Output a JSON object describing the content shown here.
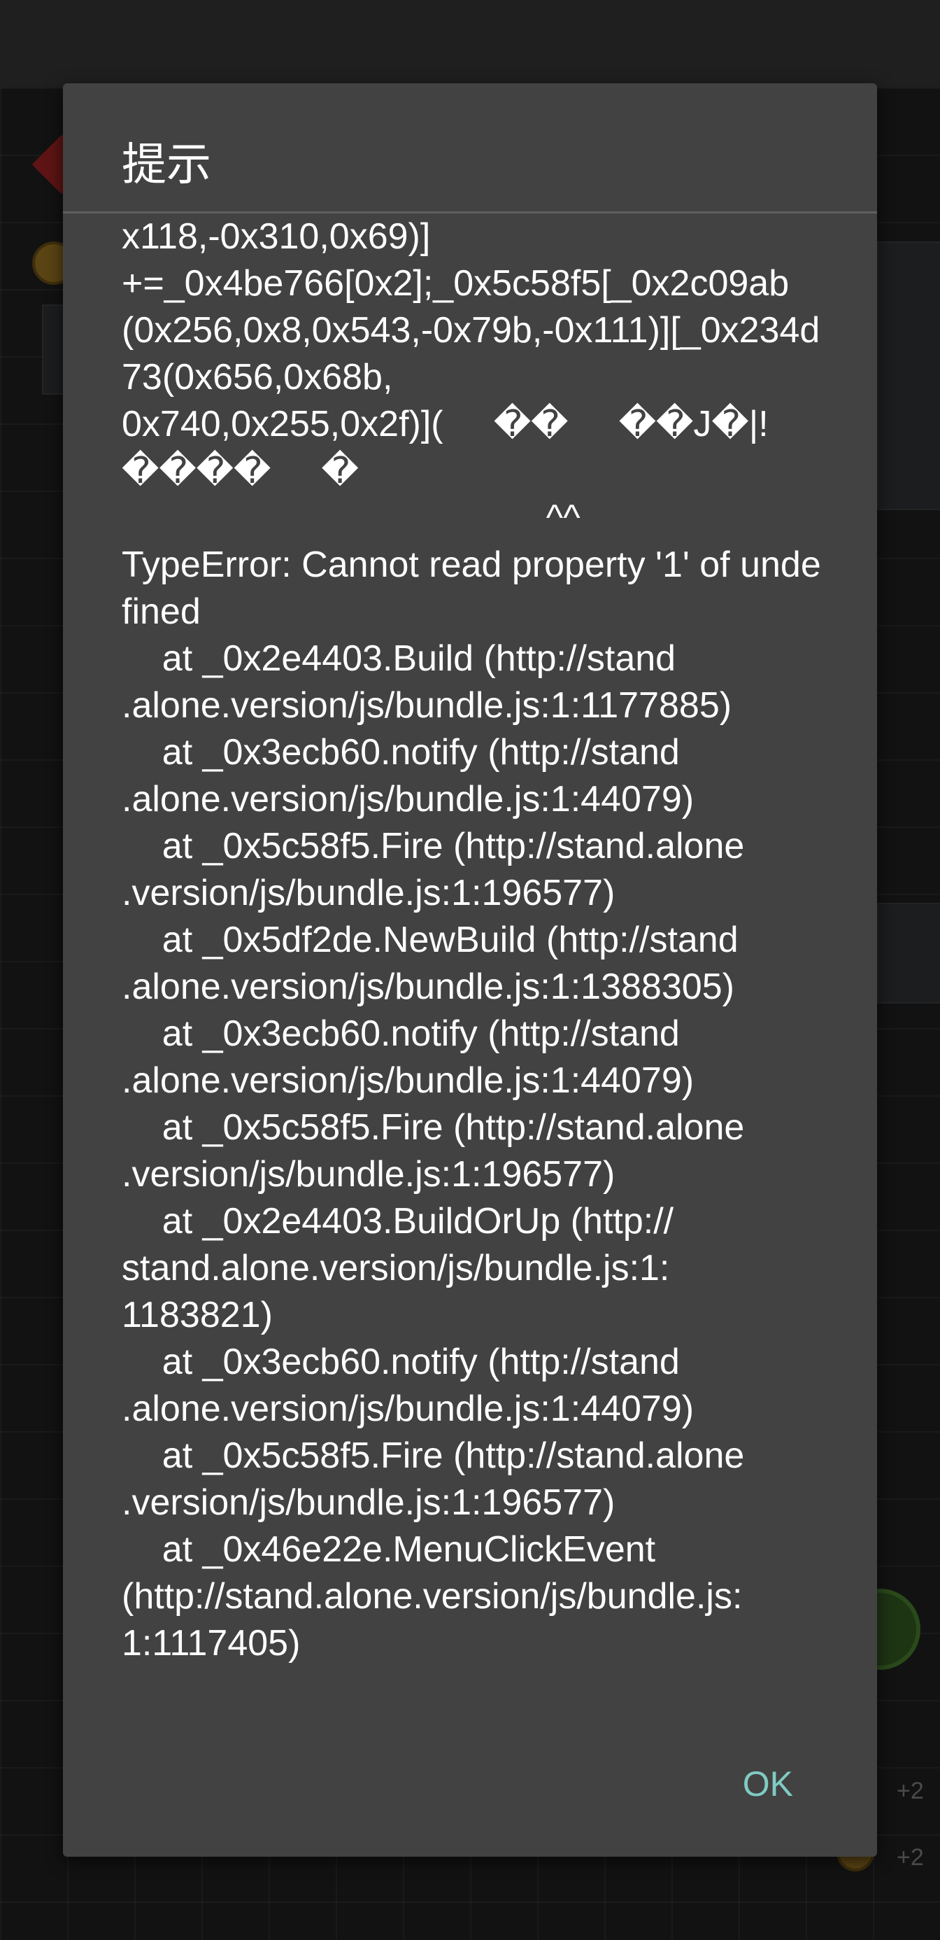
{
  "dialog": {
    "title": "提示",
    "message": "x118,-0x310,0x69)]\n+=_0x4be766[0x2];_0x5c58f5[_0x2c09ab(0x256,0x8,0x543,-0x79b,-0x111)][_0x234d73(0x656,0x68b,\n0x740,0x255,0x2f)](     ��     ��J�|!\n����     �\n                                          ^^\nTypeError: Cannot read property '1' of undefined\n    at _0x2e4403.Build (http://stand\n.alone.version/js/bundle.js:1:1177885)\n    at _0x3ecb60.notify (http://stand\n.alone.version/js/bundle.js:1:44079)\n    at _0x5c58f5.Fire (http://stand.alone\n.version/js/bundle.js:1:196577)\n    at _0x5df2de.NewBuild (http://stand\n.alone.version/js/bundle.js:1:1388305)\n    at _0x3ecb60.notify (http://stand\n.alone.version/js/bundle.js:1:44079)\n    at _0x5c58f5.Fire (http://stand.alone\n.version/js/bundle.js:1:196577)\n    at _0x2e4403.BuildOrUp (http://\nstand.alone.version/js/bundle.js:1:\n1183821)\n    at _0x3ecb60.notify (http://stand\n.alone.version/js/bundle.js:1:44079)\n    at _0x5c58f5.Fire (http://stand.alone\n.version/js/bundle.js:1:196577)\n    at _0x46e22e.MenuClickEvent\n(http://stand.alone.version/js/bundle.js:\n1:1117405)",
    "ok_label": "OK"
  },
  "background": {
    "plus_labels": [
      "+2",
      "+2"
    ]
  },
  "colors": {
    "dialog_bg": "#424242",
    "accent": "#80cbc4",
    "scrim": "#151515"
  }
}
